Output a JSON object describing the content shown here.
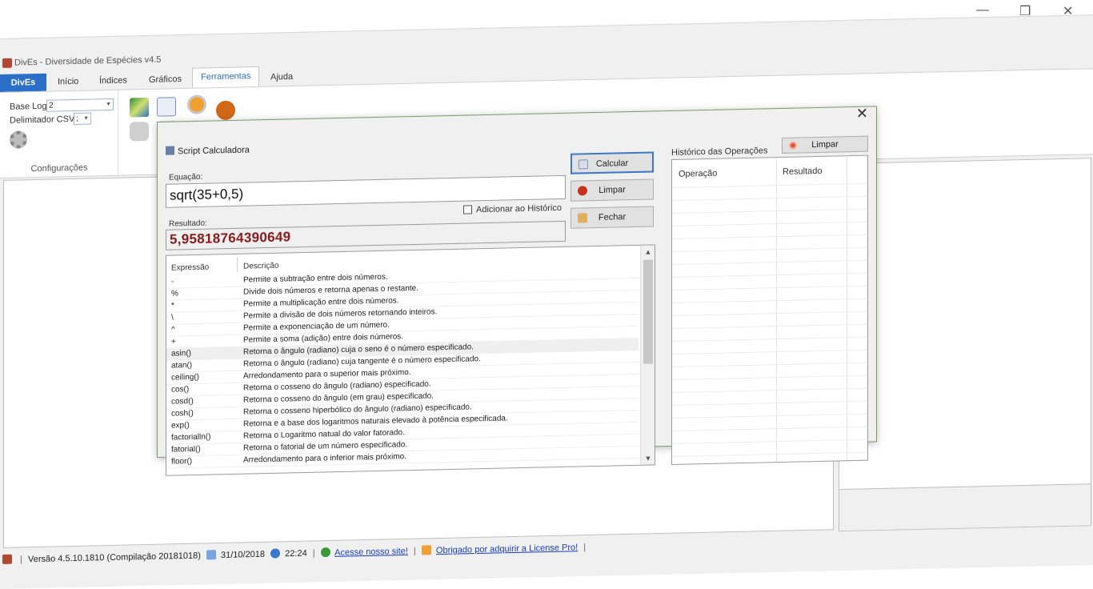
{
  "window": {
    "app_title": "DivEs - Diversidade de Espécies v4.5",
    "controls": [
      "—",
      "❐",
      "✕"
    ]
  },
  "ribbon": {
    "tabs": [
      "DivEs",
      "Início",
      "Índices",
      "Gráficos",
      "Ferramentas",
      "Ajuda"
    ],
    "active_tab": "Ferramentas",
    "config": {
      "base_log_label": "Base Log:",
      "base_log_value": "2",
      "csv_label": "Delimitador CSV:",
      "csv_value": ";",
      "group_name": "Configurações"
    }
  },
  "dialog": {
    "title": "Script Calculadora",
    "equation_label": "Equação:",
    "equation_value": "sqrt(35+0,5)",
    "add_history_label": "Adicionar ao Histórico",
    "result_label": "Resultado:",
    "result_value": "5,95818764390649",
    "buttons": {
      "calc": "Calcular",
      "clear": "Limpar",
      "close": "Fechar"
    },
    "table": {
      "headers": [
        "Expressão",
        "Descrição"
      ],
      "rows": [
        [
          "-",
          "Permite a subtração entre dois números."
        ],
        [
          "%",
          "Divide dois números e retorna apenas o restante."
        ],
        [
          "*",
          "Permite a multiplicação entre dois números."
        ],
        [
          "\\",
          "Permite a divisão de dois números retornando inteiros."
        ],
        [
          "^",
          "Permite a exponenciação de um número."
        ],
        [
          "+",
          "Permite a soma (adição) entre dois números."
        ],
        [
          "asin()",
          "Retorna o ângulo (radiano) cuja o seno é o número especificado."
        ],
        [
          "atan()",
          "Retorna o ângulo (radiano) cuja tangente é o número especificado."
        ],
        [
          "ceiling()",
          "Arredondamento para o superior mais próximo."
        ],
        [
          "cos()",
          "Retorna o cosseno do ângulo (radiano) especificado."
        ],
        [
          "cosd()",
          "Retorna o cosseno do ângulo (em grau) especificado."
        ],
        [
          "cosh()",
          "Retorna o cosseno hiperbólico do ângulo (radiano) especificado."
        ],
        [
          "exp()",
          "Retorna e a base dos logaritmos naturais elevado à potência especificada."
        ],
        [
          "factorialln()",
          "Retorna o Logaritmo natual do valor fatorado."
        ],
        [
          "fatorial()",
          "Retorna o fatorial de um número especificado."
        ],
        [
          "floor()",
          "Arredondamento para o inferior mais próximo."
        ]
      ],
      "selected_index": 6
    },
    "history": {
      "label": "Histórico das Operações",
      "clear": "Limpar",
      "headers": [
        "Operação",
        "Resultado"
      ]
    }
  },
  "status": {
    "version": "Versão 4.5.10.1810 (Compilação 20181018)",
    "date": "31/10/2018",
    "time": "22:24",
    "site_link": "Acesse nosso site!",
    "license_link": "Obrigado por adquirir a License Pro!"
  },
  "colors": {
    "accent": "#2b6fc9",
    "result_text": "#8b1a1a"
  }
}
